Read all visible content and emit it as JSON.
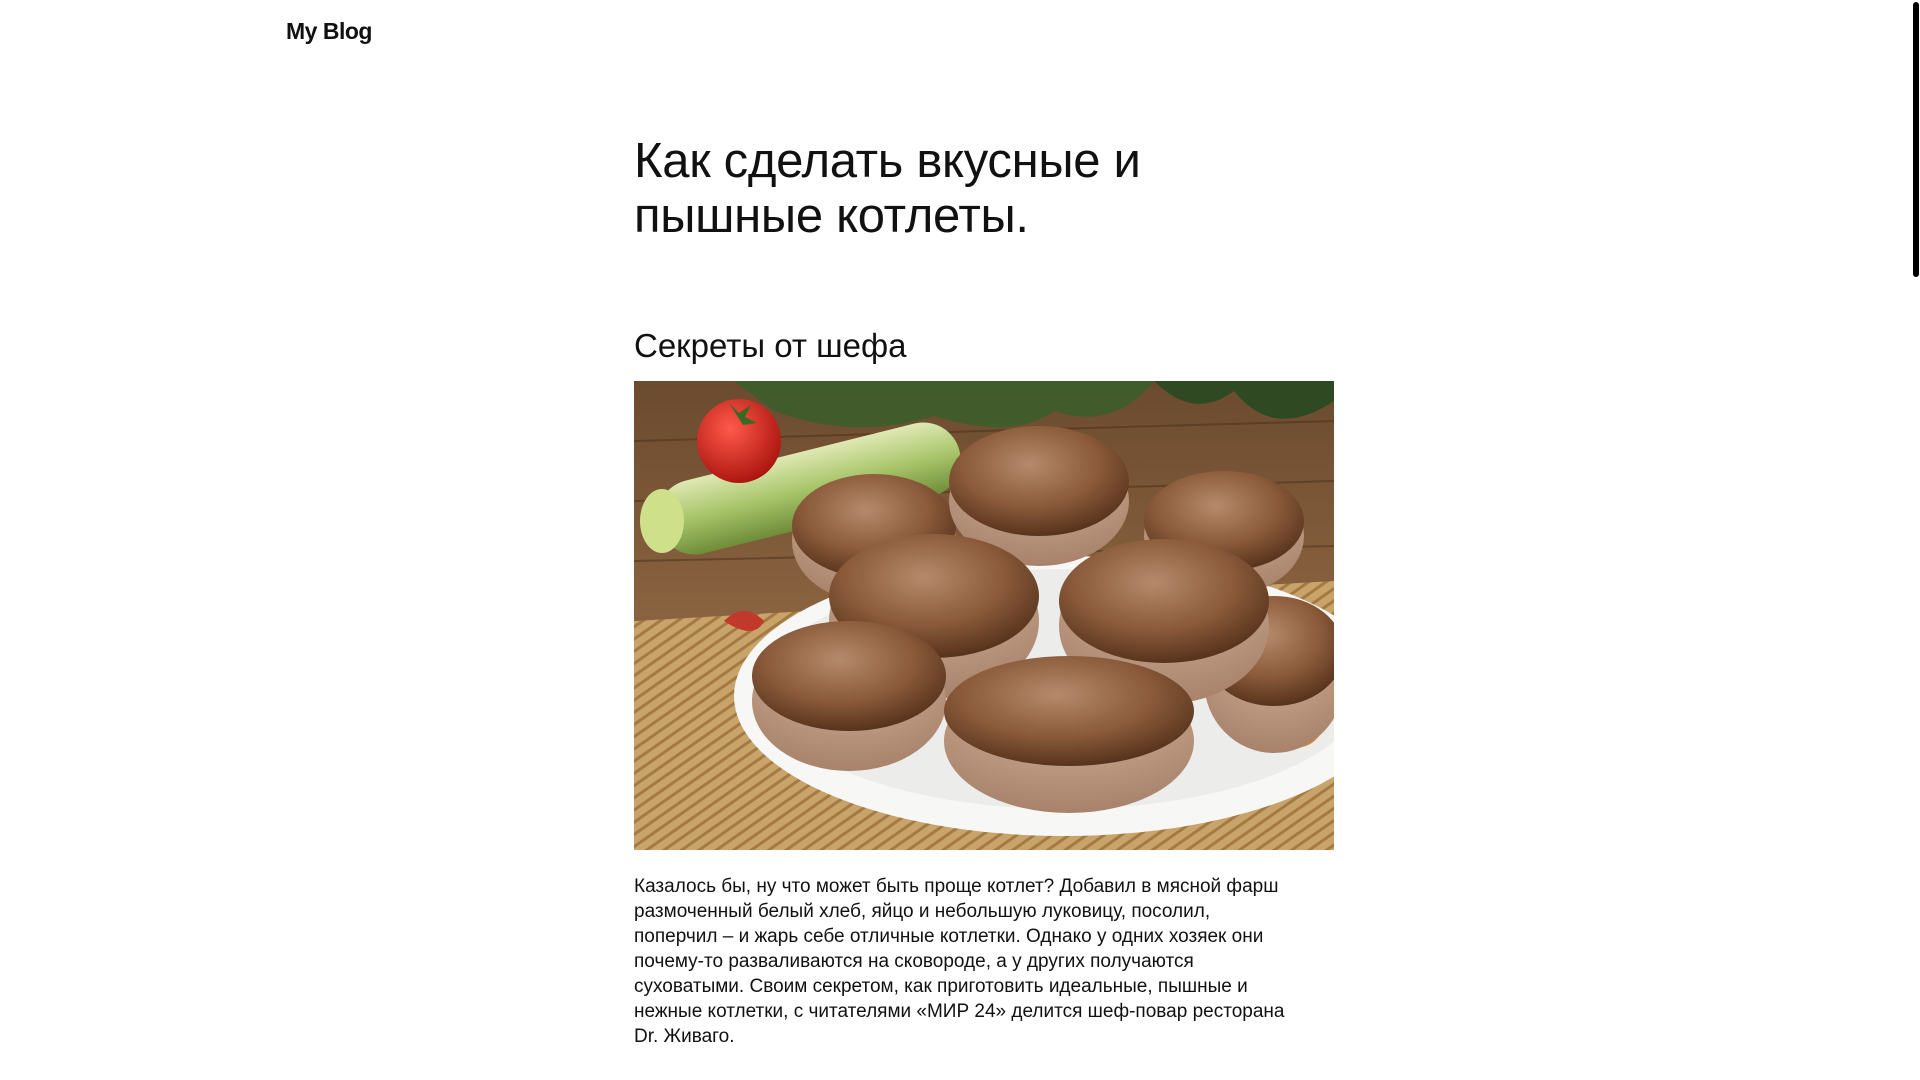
{
  "site": {
    "title": "My Blog"
  },
  "article": {
    "title": "Как сделать вкусные и пышные котлеты.",
    "section_heading": "Секреты от шефа",
    "image": {
      "icon": "food-photo-cutlets"
    },
    "paragraph": "Казалось бы, ну что может быть проще котлет? Добавил в мясной фарш размоченный белый хлеб, яйцо и небольшую луковицу, посолил, поперчил – и жарь себе отличные котлетки. Однако у одних хозяек они почему-то разваливаются на сковороде, а у других получаются суховатыми. Своим секретом, как приготовить идеальные, пышные и нежные котлетки, с читателями «МИР 24» делится шеф-повар ресторана Dr. Живаго."
  },
  "colors": {
    "text": "#111111",
    "background": "#ffffff",
    "scrollbar_thumb": "#000000"
  }
}
